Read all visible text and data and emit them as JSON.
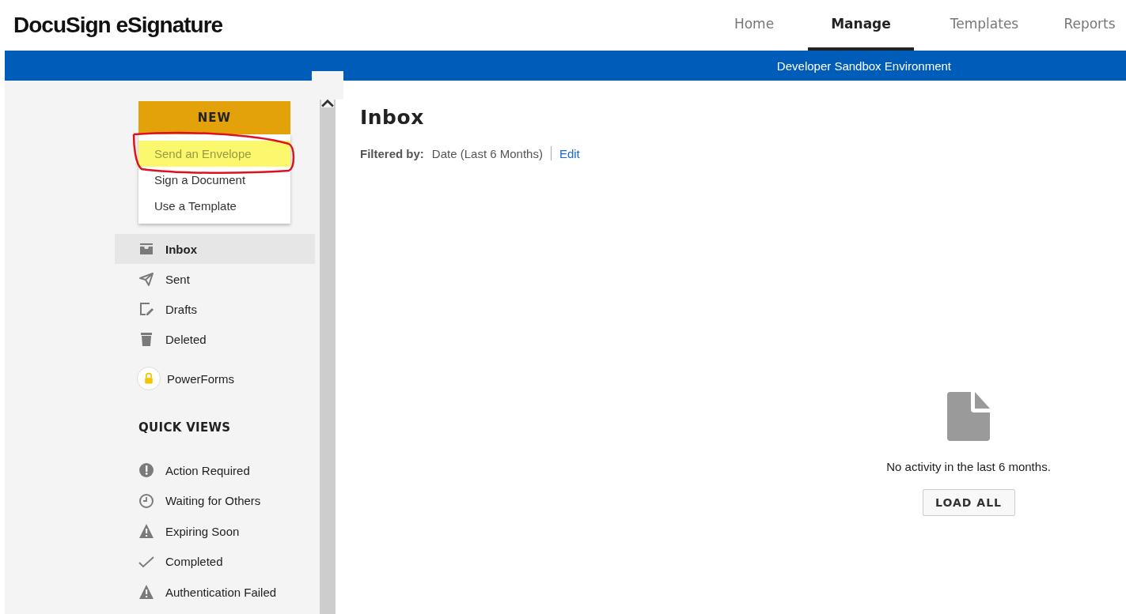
{
  "logo": "DocuSign eSignature",
  "nav_tabs": [
    {
      "label": "Home",
      "selected": false
    },
    {
      "label": "Manage",
      "selected": true
    },
    {
      "label": "Templates",
      "selected": false
    },
    {
      "label": "Reports",
      "selected": false
    }
  ],
  "banner": "Developer Sandbox Environment",
  "new_button": "NEW",
  "new_menu": [
    {
      "label": "Send an Envelope",
      "highlighted": true
    },
    {
      "label": "Sign a Document",
      "highlighted": false
    },
    {
      "label": "Use a Template",
      "highlighted": false
    }
  ],
  "folders": [
    {
      "label": "Inbox",
      "kind": "inbox",
      "selected": true
    },
    {
      "label": "Sent",
      "kind": "sent",
      "selected": false
    },
    {
      "label": "Drafts",
      "kind": "drafts",
      "selected": false
    },
    {
      "label": "Deleted",
      "kind": "deleted",
      "selected": false
    }
  ],
  "powerforms": "PowerForms",
  "quick_views_heading": "QUICK VIEWS",
  "quick_views": [
    {
      "label": "Action Required",
      "kind": "alert"
    },
    {
      "label": "Waiting for Others",
      "kind": "clock"
    },
    {
      "label": "Expiring Soon",
      "kind": "warning"
    },
    {
      "label": "Completed",
      "kind": "check"
    },
    {
      "label": "Authentication Failed",
      "kind": "warning"
    }
  ],
  "main": {
    "title": "Inbox",
    "filter_label": "Filtered by:",
    "filter_value": "Date (Last 6 Months)",
    "edit_link": "Edit",
    "empty_message": "No activity in the last 6 months.",
    "load_all_button": "LOAD ALL"
  }
}
